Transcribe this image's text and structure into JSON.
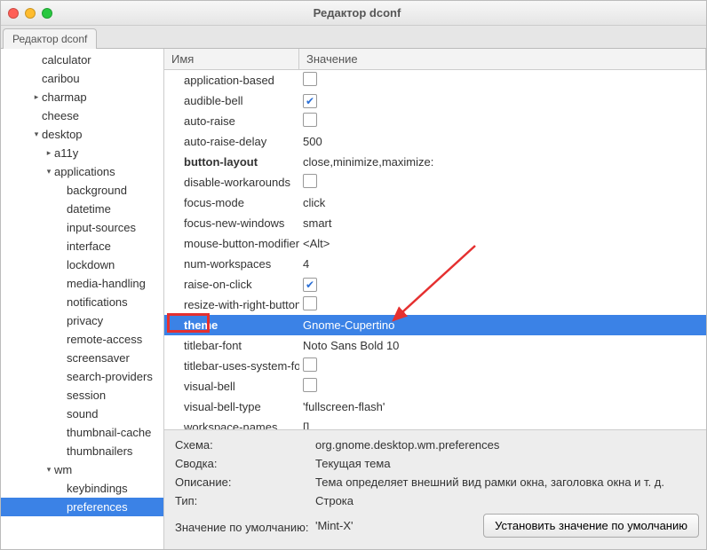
{
  "window": {
    "title": "Редактор dconf"
  },
  "tab": {
    "label": "Редактор dconf"
  },
  "columns": {
    "name": "Имя",
    "value": "Значение"
  },
  "tree": [
    {
      "label": "calculator",
      "indent": 2,
      "exp": ""
    },
    {
      "label": "caribou",
      "indent": 2,
      "exp": ""
    },
    {
      "label": "charmap",
      "indent": 2,
      "exp": "▸"
    },
    {
      "label": "cheese",
      "indent": 2,
      "exp": ""
    },
    {
      "label": "desktop",
      "indent": 2,
      "exp": "▾"
    },
    {
      "label": "a11y",
      "indent": 3,
      "exp": "▸"
    },
    {
      "label": "applications",
      "indent": 3,
      "exp": "▾"
    },
    {
      "label": "background",
      "indent": 4,
      "exp": ""
    },
    {
      "label": "datetime",
      "indent": 4,
      "exp": ""
    },
    {
      "label": "input-sources",
      "indent": 4,
      "exp": ""
    },
    {
      "label": "interface",
      "indent": 4,
      "exp": ""
    },
    {
      "label": "lockdown",
      "indent": 4,
      "exp": ""
    },
    {
      "label": "media-handling",
      "indent": 4,
      "exp": ""
    },
    {
      "label": "notifications",
      "indent": 4,
      "exp": ""
    },
    {
      "label": "privacy",
      "indent": 4,
      "exp": ""
    },
    {
      "label": "remote-access",
      "indent": 4,
      "exp": ""
    },
    {
      "label": "screensaver",
      "indent": 4,
      "exp": ""
    },
    {
      "label": "search-providers",
      "indent": 4,
      "exp": ""
    },
    {
      "label": "session",
      "indent": 4,
      "exp": ""
    },
    {
      "label": "sound",
      "indent": 4,
      "exp": ""
    },
    {
      "label": "thumbnail-cache",
      "indent": 4,
      "exp": ""
    },
    {
      "label": "thumbnailers",
      "indent": 4,
      "exp": ""
    },
    {
      "label": "wm",
      "indent": 3,
      "exp": "▾"
    },
    {
      "label": "keybindings",
      "indent": 4,
      "exp": ""
    },
    {
      "label": "preferences",
      "indent": 4,
      "exp": "",
      "sel": true
    }
  ],
  "rows": [
    {
      "name": "application-based",
      "type": "check",
      "checked": false
    },
    {
      "name": "audible-bell",
      "type": "check",
      "checked": true
    },
    {
      "name": "auto-raise",
      "type": "check",
      "checked": false
    },
    {
      "name": "auto-raise-delay",
      "type": "text",
      "value": "500"
    },
    {
      "name": "button-layout",
      "type": "text",
      "value": "close,minimize,maximize:",
      "bold": true
    },
    {
      "name": "disable-workarounds",
      "type": "check",
      "checked": false
    },
    {
      "name": "focus-mode",
      "type": "text",
      "value": "click"
    },
    {
      "name": "focus-new-windows",
      "type": "text",
      "value": "smart"
    },
    {
      "name": "mouse-button-modifier",
      "type": "text",
      "value": "<Alt>"
    },
    {
      "name": "num-workspaces",
      "type": "text",
      "value": "4"
    },
    {
      "name": "raise-on-click",
      "type": "check",
      "checked": true
    },
    {
      "name": "resize-with-right-button",
      "type": "check",
      "checked": false
    },
    {
      "name": "theme",
      "type": "text",
      "value": "Gnome-Cupertino",
      "bold": true,
      "sel": true
    },
    {
      "name": "titlebar-font",
      "type": "text",
      "value": "Noto Sans Bold 10"
    },
    {
      "name": "titlebar-uses-system-font",
      "type": "check",
      "checked": false
    },
    {
      "name": "visual-bell",
      "type": "check",
      "checked": false
    },
    {
      "name": "visual-bell-type",
      "type": "text",
      "value": "'fullscreen-flash'"
    },
    {
      "name": "workspace-names",
      "type": "text",
      "value": "[]"
    }
  ],
  "details": {
    "schema_label": "Схема:",
    "schema_value": "org.gnome.desktop.wm.preferences",
    "summary_label": "Сводка:",
    "summary_value": "Текущая тема",
    "desc_label": "Описание:",
    "desc_value": "Тема определяет внешний вид рамки окна, заголовка окна и т. д.",
    "type_label": "Тип:",
    "type_value": "Строка",
    "default_label": "Значение по умолчанию:",
    "default_value": "'Mint-X'",
    "reset_button": "Установить значение по умолчанию"
  }
}
